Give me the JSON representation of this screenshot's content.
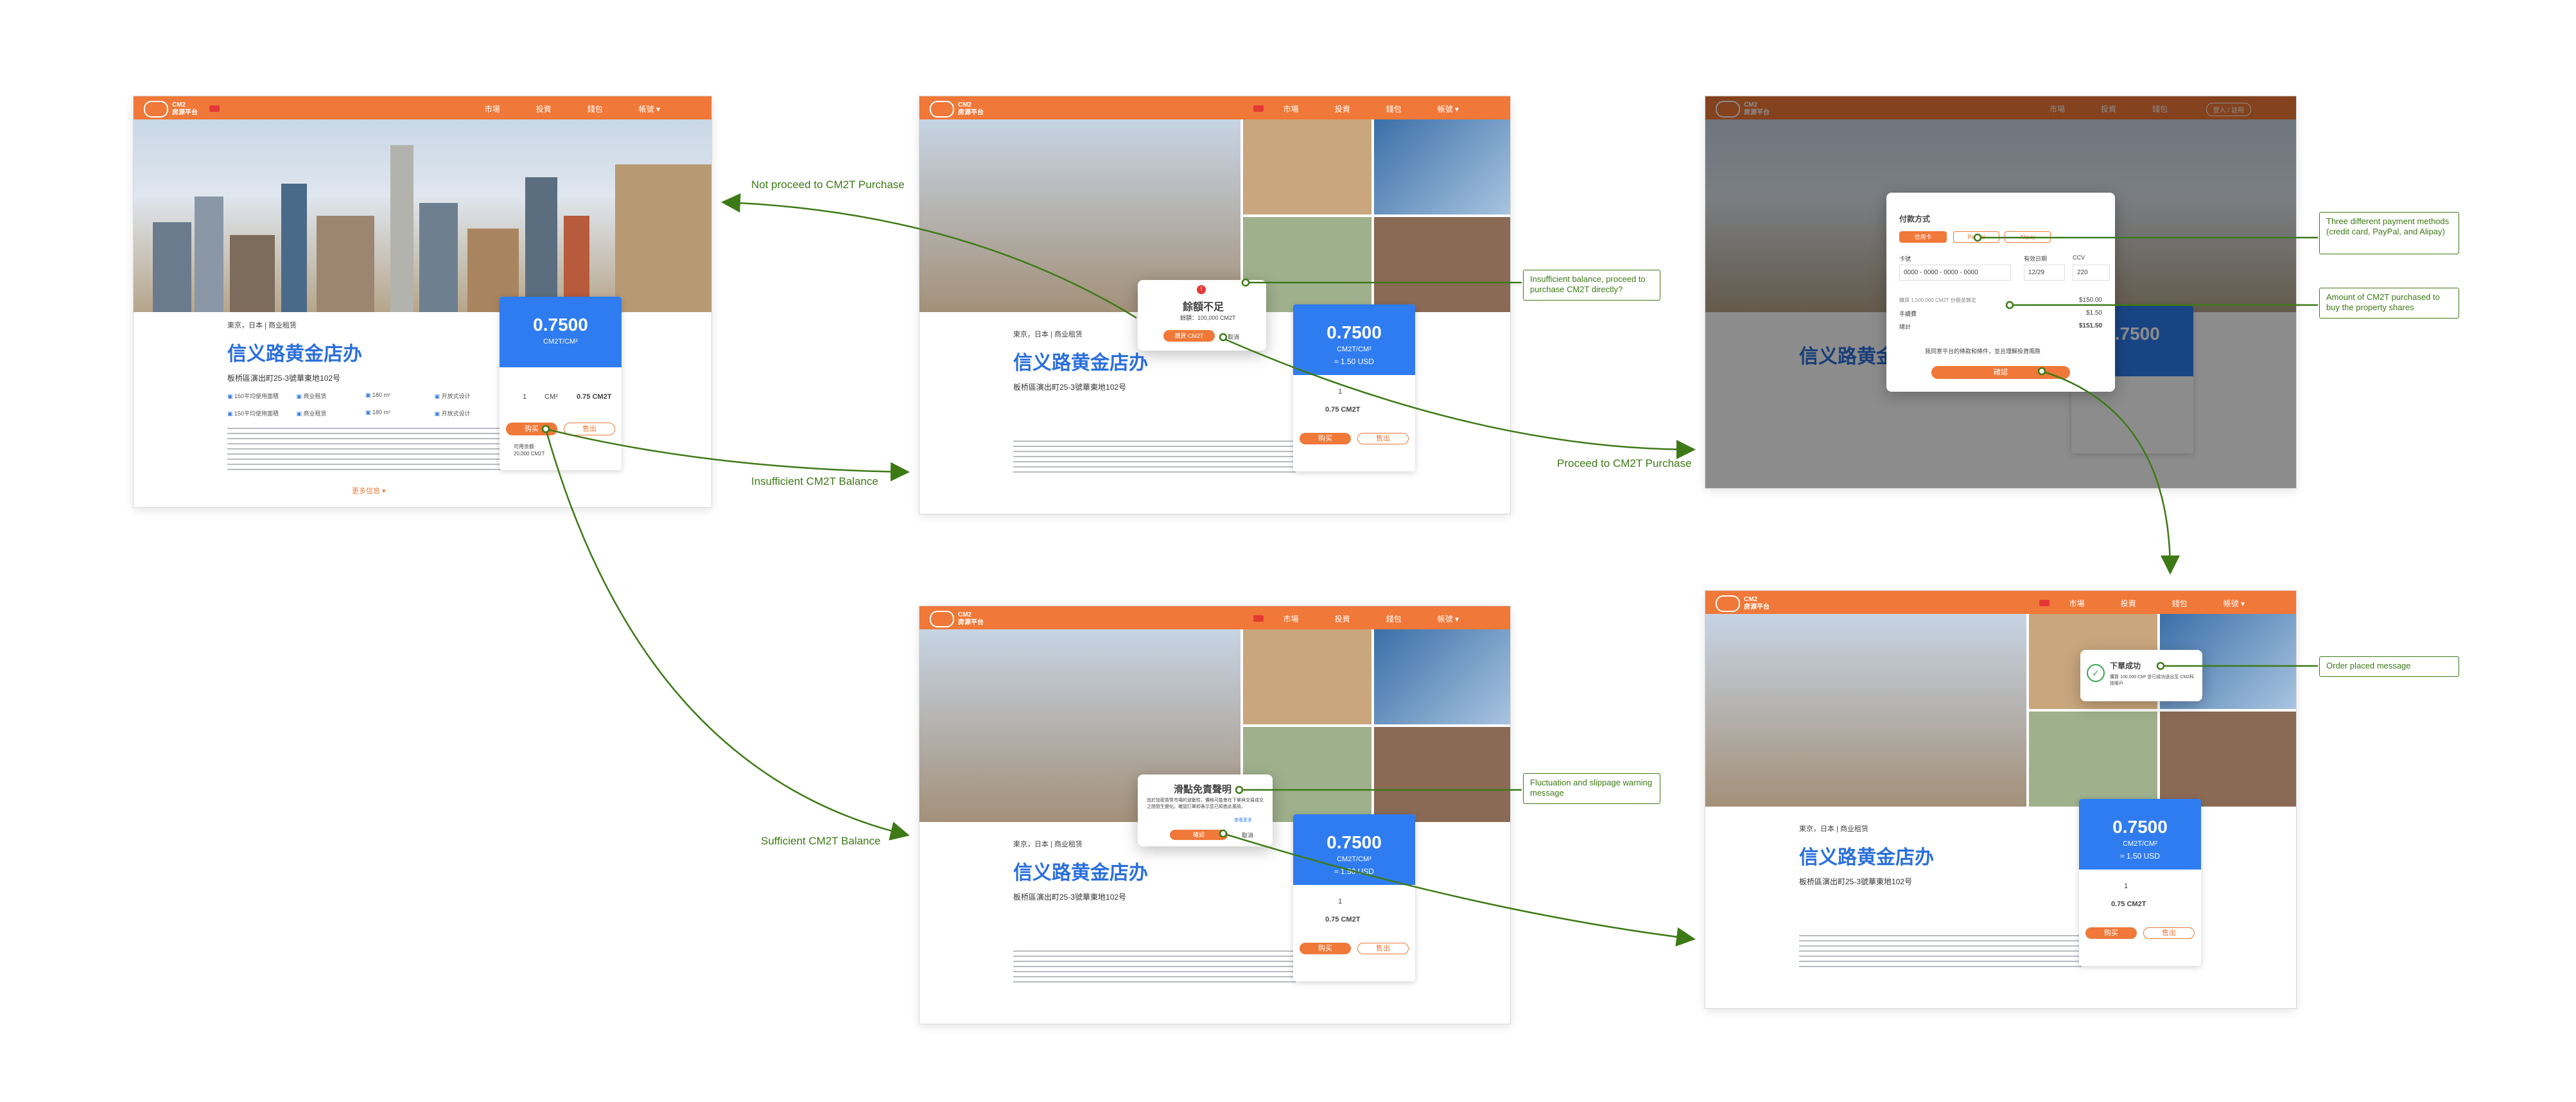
{
  "brand": {
    "name": "CM2",
    "sub": "房源平台",
    "accent": "#f07838",
    "blue": "#2f7cf0",
    "annotation_green": "#3d7a16"
  },
  "nav": {
    "items": [
      "市場",
      "投資",
      "錢包",
      "帳號 ▾"
    ],
    "login_btn": "登入 / 註冊"
  },
  "listing": {
    "location": "東京，日本 | 商业租赁",
    "title": "信义路黄金店办",
    "address": "板桥區演出町25-3號華東地102号",
    "features": [
      "150平均使用面積",
      "商业租赁",
      "180 m²",
      "开放式设计",
      "150平均使用面積",
      "商业租赁",
      "180 m²",
      "开放式设计"
    ],
    "more": "更多信息 ▾"
  },
  "card": {
    "price": "0.7500",
    "unit": "CM2T/CM²",
    "usd": "≈ 1.50 USD",
    "qty": "1",
    "qty_unit": "CM²",
    "total": "0.75 CM2T",
    "buy": "购买",
    "sell": "售出",
    "available": "可用余额",
    "available_value": "20,000 CM2T"
  },
  "modal_insufficient": {
    "title": "餘額不足",
    "line": "餘額：100,000 CM2T",
    "btn": "購買 CM2T",
    "cancel": "取消"
  },
  "modal_disclaimer": {
    "title": "滑點免責聲明",
    "text": "由於加密貨幣市場的波動性，價格可能會在下單與交易成交之間發生變化。確認訂單即表示您已知悉此風險。",
    "link": "查看更多",
    "btn": "確認",
    "cancel": "取消"
  },
  "modal_payment": {
    "title": "付款方式",
    "methods": [
      "信用卡",
      "Paypal",
      "Alipay"
    ],
    "card_label": "卡號",
    "card_number": "0000 - 0000 - 0000 - 0000",
    "exp_label": "有效日期",
    "exp": "12/29",
    "cvv_label": "CCV",
    "cvv": "220",
    "rows": [
      {
        "label": "購買 1,500,000 CM2T 份额並鎖定",
        "value": "$150.00"
      },
      {
        "label": "手續費",
        "value": "$1.50"
      },
      {
        "label": "總計",
        "value": "$151.50"
      }
    ],
    "agree": "我同意平台的條款和條件，並且理解投資風險",
    "confirm": "確認"
  },
  "toast": {
    "title": "下單成功",
    "text": "購買 100,000 CM² 並已成功送出至 CM2科技賬戶"
  },
  "flows": {
    "not_proceed": "Not proceed to CM2T Purchase",
    "insufficient": "Insufficient CM2T Balance",
    "proceed": "Proceed to CM2T Purchase",
    "sufficient": "Sufficient CM2T Balance"
  },
  "annotations": {
    "insufficient_q": "Insufficient balance, proceed to purchase CM2T directly?",
    "payment_methods": "Three different payment methods (credit card, PayPal, and Alipay)",
    "amount": "Amount of CM2T purchased to buy the property shares",
    "order_placed": "Order placed message",
    "slippage": "Fluctuation and slippage warning message"
  }
}
